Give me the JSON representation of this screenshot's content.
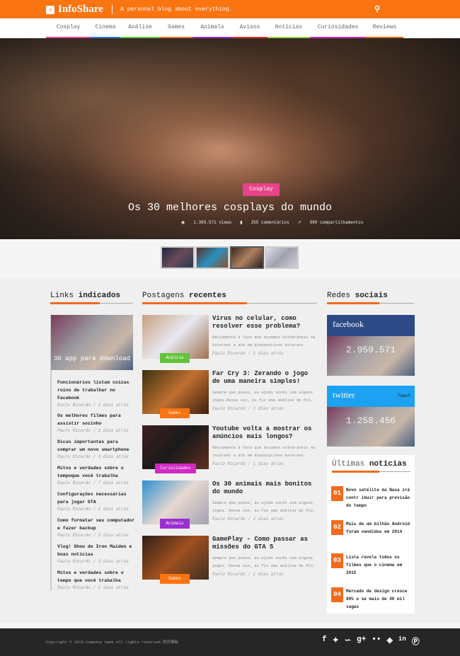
{
  "header": {
    "logo": "InfoShare",
    "tagline": "A personal blog about everything.",
    "search_icon": "search-icon",
    "accent": "#fb7412"
  },
  "nav": [
    {
      "label": "Cosplay",
      "color": "#e8428a"
    },
    {
      "label": "Cinema",
      "color": "#2f7ae5"
    },
    {
      "label": "Análise",
      "color": "#63c43c"
    },
    {
      "label": "Games",
      "color": "#fb7412"
    },
    {
      "label": "Animals",
      "color": "#9b2fd0"
    },
    {
      "label": "Avisos",
      "color": "#e5322e"
    },
    {
      "label": "Notícias",
      "color": "#9ad83a"
    },
    {
      "label": "Curiosidades",
      "color": "#d22ac4"
    },
    {
      "label": "Reviews",
      "color": "#d9661c"
    }
  ],
  "hero": {
    "category": "Cosplay",
    "title": "Os 30 melhores cosplays do mundo",
    "views": "1.389.571 views",
    "comments": "255 comentários",
    "shares": "980 compartilhamentos"
  },
  "links": {
    "title_a": "Links",
    "title_b": "indicados",
    "featured": "30 app para download",
    "items": [
      {
        "t": "Funcionários listam coizas ruins de trabalhar no Facebook",
        "m": "Paulo Ricardo / 3 dias atrás"
      },
      {
        "t": "Os melhores filmes para assistir sozinho",
        "m": "Paulo Ricardo / 2 dias atrás"
      },
      {
        "t": "Dicas importantes para comprar um novo smartphone",
        "m": "Paulo Ricardo / 3 dias atrás"
      },
      {
        "t": "Mitos e verdades sobre o tempoque você trabalha",
        "m": "Paulo Ricardo / 7 dias atrás"
      },
      {
        "t": "Configurações necessárias para jogar GTA",
        "m": "Paulo Ricardo / 1 dias atrás"
      },
      {
        "t": "Como formatar seu computador e fazer backup",
        "m": "Paulo Ricardo / 3 dias atrás"
      },
      {
        "t": "Vlog! Show do Iron Maiden e boas notícias",
        "m": "Paulo Ricardo / 3 dias atrás"
      },
      {
        "t": "Mitos e verdades sobre o tempo que você trabalha",
        "m": "Paulo Ricardo / 2 dias atrás"
      }
    ]
  },
  "posts": {
    "title_a": "Postagens",
    "title_b": "recentes",
    "items": [
      {
        "t": "Vírus no celular, como resolver esse problema?",
        "d": "Obviamente é fato que estamos vulneráveis na internet e até em dispositivos externos.",
        "m": "Paulo Ricardo / 1 dias atrás",
        "badge": "Análise",
        "color": "#63c43c"
      },
      {
        "t": "Far Cry 3: Zerando o jogo de uma maneira simples!",
        "d": "Sempre que posso, eu ajudo vocês com alguns jogos.Dessa vez, eu fiz uma análise de PC3.",
        "m": "Paulo Ricardo / 1 dias atrás",
        "badge": "Games",
        "color": "#fb7412"
      },
      {
        "t": "Youtube volta a mostrar os anúncios mais longos?",
        "d": "Obviamente é fato que estamos vulneráveis na internet e até em dispositivos externos.",
        "m": "Paulo Ricardo / 1 dias atrás",
        "badge": "Curiosidades",
        "color": "#d22ac4"
      },
      {
        "t": "Os 30 animais mais bonitos do mundo",
        "d": "Sempre que posso, eu ajudo vocês com alguns jogos. Dessa vez, eu fiz uma análise de PC3.",
        "m": "Paulo Ricardo / 1 dias atrás",
        "badge": "Animais",
        "color": "#9b2fd0"
      },
      {
        "t": "GamePlay - Como passar as missões do GTA 5",
        "d": "Sempre que posso, eu ajudo vocês com alguns jogos. Dessa vez, eu fiz uma análise de PC3.",
        "m": "Paulo Ricardo / 1 dias atrás",
        "badge": "Games",
        "color": "#fb7412"
      }
    ]
  },
  "social": {
    "title_a": "Redes",
    "title_b": "sociais",
    "facebook": {
      "name": "facebook",
      "count": "2.959.571",
      "color": "#2d4a86"
    },
    "twitter": {
      "name": "twitter",
      "count": "1.258.456",
      "tweet": "Tweet",
      "color": "#1da1f2"
    }
  },
  "news": {
    "title_a": "Últimas",
    "title_b": "notícias",
    "items": [
      {
        "n": "01",
        "t": "Novo satélite da Nasa irá contr ibuir para previsão do tempo"
      },
      {
        "n": "02",
        "t": "Mais de um bilhão Android foram vendidos em 2014"
      },
      {
        "n": "03",
        "t": "Lista revela todos os filmes que o cinema em 2015"
      },
      {
        "n": "04",
        "t": "Mercado de design cresce 80% e se mais de 40 mil vagas"
      }
    ]
  },
  "footer": {
    "copyright": "Copyright © 2015.Company name All rights reserved.网页模板",
    "icons": [
      "facebook-icon",
      "twitter-icon",
      "rss-icon",
      "google-plus-icon",
      "flickr-icon",
      "dribbble-icon",
      "linkedin-icon",
      "pinterest-icon"
    ]
  }
}
